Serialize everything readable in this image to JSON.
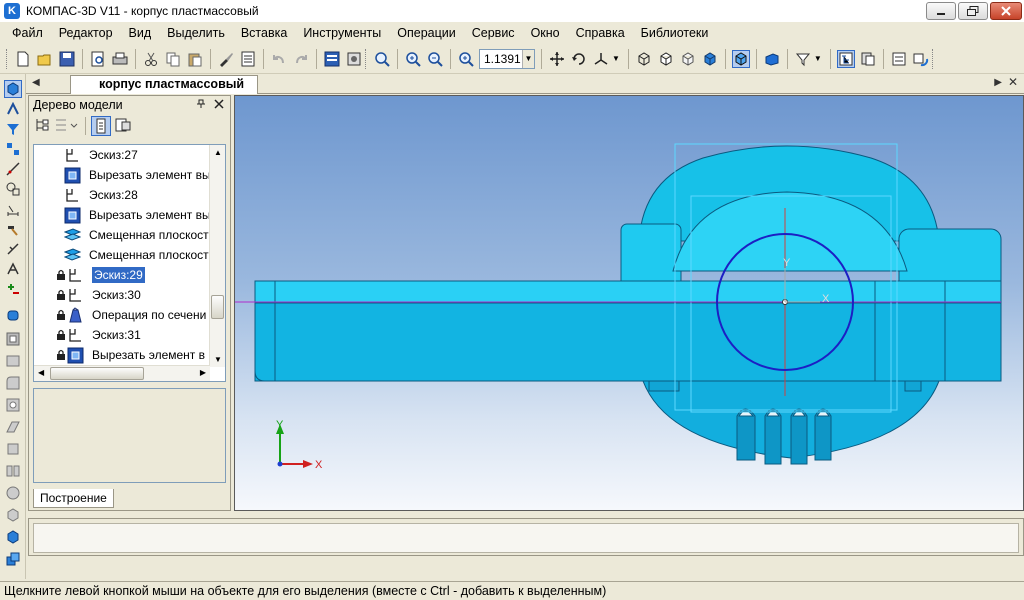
{
  "window": {
    "title": "КОМПАС-3D V11 - корпус пластмассовый",
    "app_icon_letter": "K"
  },
  "menu": [
    {
      "label": "Файл"
    },
    {
      "label": "Редактор"
    },
    {
      "label": "Вид"
    },
    {
      "label": "Выделить"
    },
    {
      "label": "Вставка"
    },
    {
      "label": "Инструменты"
    },
    {
      "label": "Операции"
    },
    {
      "label": "Сервис"
    },
    {
      "label": "Окно"
    },
    {
      "label": "Справка"
    },
    {
      "label": "Библиотеки"
    }
  ],
  "toolbar": {
    "zoom_value": "1.1391"
  },
  "document_tab": {
    "label": "корпус пластмассовый"
  },
  "model_tree": {
    "title": "Дерево модели",
    "items": [
      {
        "label": "Эскиз:27",
        "icon": "sketch-icon",
        "locked": false,
        "selected": false
      },
      {
        "label": "Вырезать элемент вы",
        "icon": "cut-extrude-icon",
        "locked": false,
        "selected": false
      },
      {
        "label": "Эскиз:28",
        "icon": "sketch-icon",
        "locked": false,
        "selected": false
      },
      {
        "label": "Вырезать элемент вы",
        "icon": "cut-extrude-icon",
        "locked": false,
        "selected": false
      },
      {
        "label": "Смещенная плоскост",
        "icon": "offset-plane-icon",
        "locked": false,
        "selected": false
      },
      {
        "label": "Смещенная плоскост",
        "icon": "offset-plane-icon",
        "locked": false,
        "selected": false
      },
      {
        "label": "Эскиз:29",
        "icon": "sketch-icon",
        "locked": true,
        "selected": true
      },
      {
        "label": "Эскиз:30",
        "icon": "sketch-icon",
        "locked": true,
        "selected": false
      },
      {
        "label": "Операция по сечени",
        "icon": "loft-icon",
        "locked": true,
        "selected": false
      },
      {
        "label": "Эскиз:31",
        "icon": "sketch-icon",
        "locked": true,
        "selected": false
      },
      {
        "label": "Вырезать элемент в",
        "icon": "cut-extrude-icon",
        "locked": true,
        "selected": false
      }
    ],
    "bottom_tab": "Построение"
  },
  "viewport": {
    "axis_labels": {
      "y": "Y",
      "x": "X"
    },
    "model_color": "#19c7ec",
    "background_top": "#6e97cf"
  },
  "status_bar": {
    "text": "Щелкните левой кнопкой мыши на объекте для его выделения (вместе с Ctrl - добавить к выделенным)"
  }
}
